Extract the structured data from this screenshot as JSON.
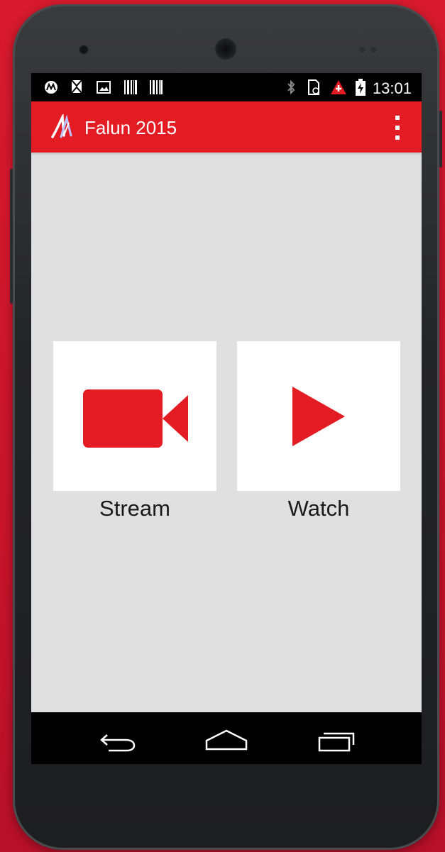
{
  "status_bar": {
    "time": "13:01",
    "left_icons": [
      "motorola-icon",
      "mms-icon",
      "image-icon",
      "barcode-icon",
      "barcode-icon"
    ],
    "right_icons": [
      "bluetooth-icon",
      "sim-icon",
      "warning-icon",
      "battery-charging-icon"
    ]
  },
  "app_bar": {
    "title": "Falun 2015",
    "logo": "falun-logo-icon",
    "menu": "overflow-menu-icon"
  },
  "actions": [
    {
      "label": "Stream",
      "icon": "video-camera-icon"
    },
    {
      "label": "Watch",
      "icon": "play-icon"
    }
  ],
  "nav_bar": [
    "back-icon",
    "home-icon",
    "recents-icon"
  ],
  "colors": {
    "accent": "#e31b23",
    "background": "#e0e0e0",
    "device_background": "#d81a2e"
  }
}
